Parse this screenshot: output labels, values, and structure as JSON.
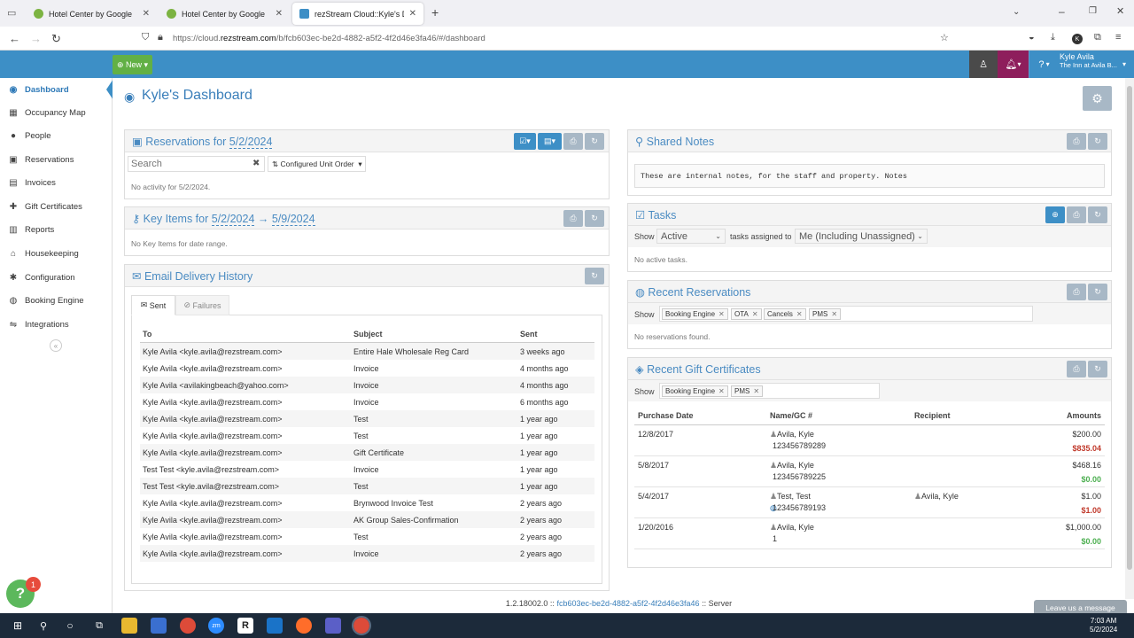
{
  "browser": {
    "tabs": [
      {
        "title": "Hotel Center by Google"
      },
      {
        "title": "Hotel Center by Google"
      },
      {
        "title": "rezStream Cloud::Kyle's Dashboard"
      }
    ],
    "url_prefix": "https://cloud.",
    "url_domain": "rezstream.com",
    "url_rest": "/b/fcb603ec-be2d-4882-a5f2-4f2d46e3fa46/#/dashboard"
  },
  "header": {
    "new_label": "New",
    "user_name": "Kyle Avila",
    "property": "The Inn at Avila B..."
  },
  "sidebar": {
    "items": [
      {
        "label": "Dashboard",
        "icon": "dashboard-icon",
        "glyph": "◉"
      },
      {
        "label": "Occupancy Map",
        "icon": "calendar-icon",
        "glyph": "▦"
      },
      {
        "label": "People",
        "icon": "person-icon",
        "glyph": "●"
      },
      {
        "label": "Reservations",
        "icon": "suitcase-icon",
        "glyph": "▣"
      },
      {
        "label": "Invoices",
        "icon": "table-icon",
        "glyph": "▤"
      },
      {
        "label": "Gift Certificates",
        "icon": "gift-icon",
        "glyph": "✚"
      },
      {
        "label": "Reports",
        "icon": "bar-chart-icon",
        "glyph": "▥"
      },
      {
        "label": "Housekeeping",
        "icon": "broom-icon",
        "glyph": "⌂"
      },
      {
        "label": "Configuration",
        "icon": "cog-icon",
        "glyph": "✱"
      },
      {
        "label": "Booking Engine",
        "icon": "globe-icon",
        "glyph": "◍"
      },
      {
        "label": "Integrations",
        "icon": "handshake-icon",
        "glyph": "⇋"
      }
    ],
    "collapse_glyph": "«"
  },
  "dashboard": {
    "title": "Kyle's Dashboard"
  },
  "reservations_panel": {
    "title_prefix": "Reservations for ",
    "date": "5/2/2024",
    "search_placeholder": "Search",
    "order_label": "Configured Unit Order",
    "empty": "No activity for 5/2/2024."
  },
  "key_items_panel": {
    "title_prefix": "Key Items for ",
    "start": "5/2/2024",
    "arrow": " → ",
    "end": "5/9/2024",
    "empty": "No Key Items for date range."
  },
  "email_panel": {
    "title": "Email Delivery History",
    "tab_sent": "Sent",
    "tab_failures": "Failures",
    "headers": {
      "to": "To",
      "subject": "Subject",
      "sent": "Sent"
    },
    "rows": [
      {
        "to": "Kyle Avila <kyle.avila@rezstream.com>",
        "subject": "Entire Hale Wholesale Reg Card",
        "sent": "3 weeks ago"
      },
      {
        "to": "Kyle Avila <kyle.avila@rezstream.com>",
        "subject": "Invoice",
        "sent": "4 months ago"
      },
      {
        "to": "Kyle Avila <avilakingbeach@yahoo.com>",
        "subject": "Invoice",
        "sent": "4 months ago"
      },
      {
        "to": "Kyle Avila <kyle.avila@rezstream.com>",
        "subject": "Invoice",
        "sent": "6 months ago"
      },
      {
        "to": "Kyle Avila <kyle.avila@rezstream.com>",
        "subject": "Test",
        "sent": "1 year ago"
      },
      {
        "to": "Kyle Avila <kyle.avila@rezstream.com>",
        "subject": "Test",
        "sent": "1 year ago"
      },
      {
        "to": "Kyle Avila <kyle.avila@rezstream.com>",
        "subject": "Gift Certificate",
        "sent": "1 year ago"
      },
      {
        "to": "Test Test <kyle.avila@rezstream.com>",
        "subject": "Invoice",
        "sent": "1 year ago"
      },
      {
        "to": "Test Test <kyle.avila@rezstream.com>",
        "subject": "Test",
        "sent": "1 year ago"
      },
      {
        "to": "Kyle Avila <kyle.avila@rezstream.com>",
        "subject": "Brynwood Invoice Test",
        "sent": "2 years ago"
      },
      {
        "to": "Kyle Avila <kyle.avila@rezstream.com>",
        "subject": "AK Group Sales-Confirmation",
        "sent": "2 years ago"
      },
      {
        "to": "Kyle Avila <kyle.avila@rezstream.com>",
        "subject": "Test",
        "sent": "2 years ago"
      },
      {
        "to": "Kyle Avila <kyle.avila@rezstream.com>",
        "subject": "Invoice",
        "sent": "2 years ago"
      }
    ]
  },
  "notes_panel": {
    "title": "Shared Notes",
    "text": "These are internal notes, for the staff and property. Notes"
  },
  "tasks_panel": {
    "title": "Tasks",
    "show_label": "Show",
    "status": "Active",
    "assigned_label": "tasks assigned to",
    "assignee": "Me (Including Unassigned)",
    "empty": "No active tasks."
  },
  "recent_res_panel": {
    "title": "Recent Reservations",
    "show_label": "Show",
    "chips": [
      "Booking Engine",
      "OTA",
      "Cancels",
      "PMS"
    ],
    "empty": "No reservations found."
  },
  "gift_panel": {
    "title": "Recent Gift Certificates",
    "show_label": "Show",
    "chips": [
      "Booking Engine",
      "PMS"
    ],
    "headers": {
      "date": "Purchase Date",
      "name": "Name/GC #",
      "recipient": "Recipient",
      "amounts": "Amounts"
    },
    "rows": [
      {
        "date": "12/8/2017",
        "name": "Avila, Kyle",
        "gc": "123456789289",
        "recipient": "",
        "amount": "$200.00",
        "balance": "$835.04",
        "balance_color": "red"
      },
      {
        "date": "5/8/2017",
        "name": "Avila, Kyle",
        "gc": "123456789225",
        "recipient": "",
        "amount": "$468.16",
        "balance": "$0.00",
        "balance_color": "green"
      },
      {
        "date": "5/4/2017",
        "name": "Test, Test",
        "gc": "123456789193",
        "recipient": "Avila, Kyle",
        "amount": "$1.00",
        "balance": "$1.00",
        "balance_color": "red"
      },
      {
        "date": "1/20/2016",
        "name": "Avila, Kyle",
        "gc": "1",
        "recipient": "",
        "amount": "$1,000.00",
        "balance": "$0.00",
        "balance_color": "green"
      }
    ]
  },
  "footer": {
    "version": "1.2.18002.0 :: ",
    "id": "fcb603ec-be2d-4882-a5f2-4f2d46e3fa46",
    "suffix": " :: Server"
  },
  "widgets": {
    "help_glyph": "?",
    "help_badge": "1",
    "leave_message": "Leave us a message"
  },
  "taskbar": {
    "time": "7:03 AM",
    "date": "5/2/2024"
  }
}
